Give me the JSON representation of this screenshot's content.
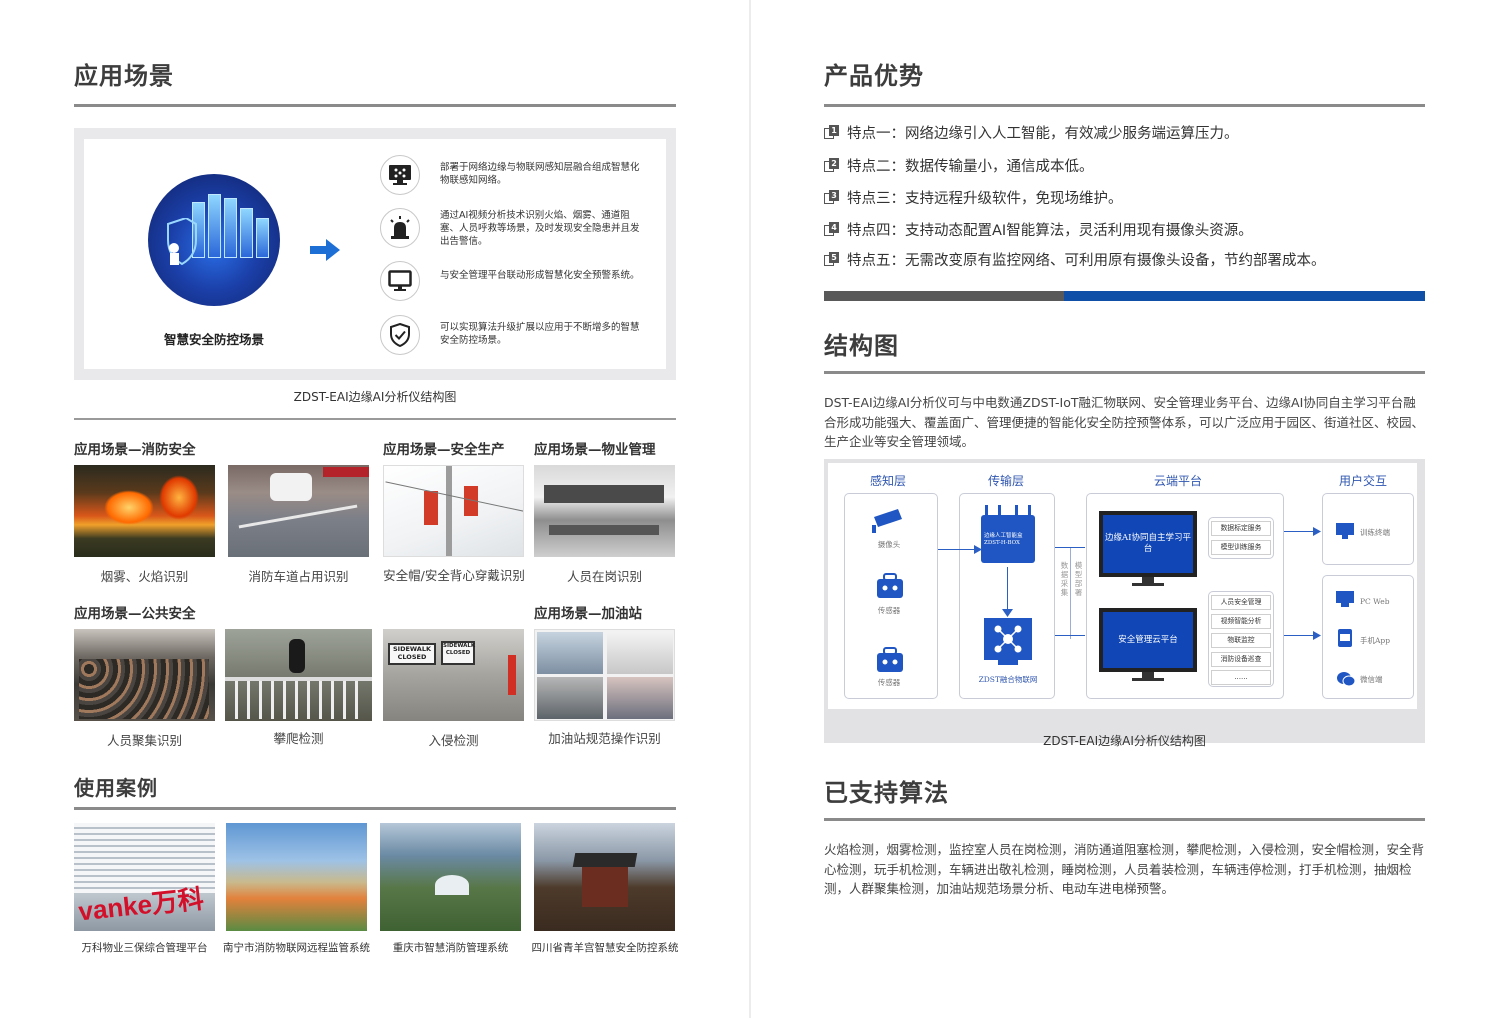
{
  "left": {
    "title": "应用场景",
    "panel": {
      "scene_title": "智慧安全防控场景",
      "features": [
        {
          "icon": "monitor-network-icon",
          "text": "部署于网络边缘与物联网感知层融合组成智慧化物联感知网络。"
        },
        {
          "icon": "alarm-light-icon",
          "text": "通过AI视频分析技术识别火焰、烟雾、通道阻塞、人员呼救等场景，及时发现安全隐患并且发出告警信。"
        },
        {
          "icon": "desktop-icon",
          "text": "与安全管理平台联动形成智慧化安全预警系统。"
        },
        {
          "icon": "shield-check-icon",
          "text": "可以实现算法升级扩展以应用于不断增多的智慧安全防控场景。"
        }
      ]
    },
    "panel_caption": "ZDST-EAI边缘AI分析仪结构图",
    "sections": {
      "fire": "应用场景—消防安全",
      "production": "应用场景—安全生产",
      "property": "应用场景—物业管理",
      "public": "应用场景—公共安全",
      "gas": "应用场景—加油站"
    },
    "photos_row1": [
      "烟雾、火焰识别",
      "消防车道占用识别",
      "安全帽/安全背心穿戴识别",
      "人员在岗识别"
    ],
    "photos_row2": [
      "人员聚集识别",
      "攀爬检测",
      "入侵检测",
      "加油站规范操作识别"
    ],
    "photo_signs": {
      "sign1": "SIDEWALK CLOSED",
      "sign2": "SIDEWALK CLOSED"
    },
    "cases_title": "使用案例",
    "cases": [
      "万科物业三保综合管理平台",
      "南宁市消防物联网远程监管系统",
      "重庆市智慧消防管理系统",
      "四川省青羊宫智慧安全防控系统"
    ],
    "vanke_logo": "vanke万科"
  },
  "right": {
    "adv_title": "产品优势",
    "features": [
      {
        "num": "1",
        "text": "特点一：网络边缘引入人工智能，有效减少服务端运算压力。"
      },
      {
        "num": "2",
        "text": "特点二：数据传输量小，通信成本低。"
      },
      {
        "num": "3",
        "text": "特点三：支持远程升级软件，免现场维护。"
      },
      {
        "num": "4",
        "text": "特点四：支持动态配置AI智能算法，灵活利用现有摄像头资源。"
      },
      {
        "num": "5",
        "text": "特点五：无需改变原有监控网络、可利用原有摄像头设备，节约部署成本。"
      }
    ],
    "progress": 0.6,
    "colors": {
      "progress_track": "#595959",
      "progress_fill": "#0f4fa7"
    },
    "struct_title": "结构图",
    "struct_para": "DST-EAI边缘AI分析仪可与中电数通ZDST-IoT融汇物联网、安全管理业务平台、边缘AI协同自主学习平台融合形成功能强大、覆盖面广、管理便捷的智能化安全防控预警体系，可以广泛应用于园区、街道社区、校园、生产企业等安全管理领域。",
    "diagram": {
      "layers": [
        "感知层",
        "传输层",
        "云端平台",
        "用户交互"
      ],
      "sense": [
        "摄像头",
        "传感器",
        "传感器"
      ],
      "edge_box": "边缘人工智能盒 ZDST-H-BOX",
      "iot": "ZDST融合物联网",
      "v1": "数据采集",
      "v2": "模型部署",
      "cloud1": "边缘AI协同自主学习平台",
      "cloud2": "安全管理云平台",
      "tags1": [
        "数据标定服务",
        "模型训练服务"
      ],
      "tags2": [
        "人员安全管理",
        "视频智能分析",
        "物联监控",
        "消防设备巡查",
        "……"
      ],
      "user1": "训练终端",
      "user2": [
        "PC Web",
        "手机App",
        "微信端"
      ]
    },
    "diagram_caption": "ZDST-EAI边缘AI分析仪结构图",
    "algo_title": "已支持算法",
    "algo_para": "火焰检测，烟雾检测，监控室人员在岗检测，消防通道阻塞检测，攀爬检测，入侵检测，安全帽检测，安全背心检测，玩手机检测，车辆进出敬礼检测，睡岗检测，人员着装检测，车辆违停检测，打手机检测，抽烟检测，人群聚集检测，加油站规范场景分析、电动车进电梯预警。"
  }
}
